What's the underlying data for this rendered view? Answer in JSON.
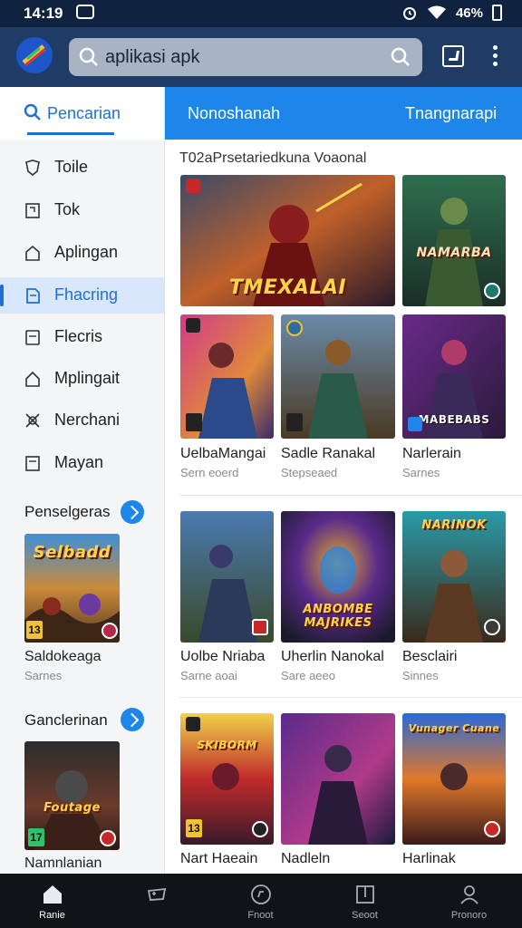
{
  "status_bar": {
    "time": "14:19",
    "battery": "46%"
  },
  "search": {
    "value": "",
    "placeholder": "aplikasi apk"
  },
  "sidebar": {
    "header_label": "Pencarian",
    "items": [
      {
        "label": "Toile",
        "icon": "shield-icon"
      },
      {
        "label": "Tok",
        "icon": "tag-icon"
      },
      {
        "label": "Aplingan",
        "icon": "house-icon"
      },
      {
        "label": "Fhacring",
        "icon": "document-icon",
        "active": true
      },
      {
        "label": "Flecris",
        "icon": "file-icon"
      },
      {
        "label": "Mplingait",
        "icon": "house-outline-icon"
      },
      {
        "label": "Nerchani",
        "icon": "grid-icon"
      },
      {
        "label": "Mayan",
        "icon": "square-icon"
      }
    ],
    "sections": [
      {
        "title": "Penselgeras",
        "card_title": "Saldokeaga",
        "card_sub": "Sarnes",
        "card_art": "Selbadd",
        "age": "13"
      },
      {
        "title": "Ganclerinan",
        "card_title": "Namnlanian",
        "card_sub": "",
        "card_art": "Foutage",
        "age": "17"
      }
    ]
  },
  "tabs": [
    {
      "label": "Nonoshanah",
      "active": true
    },
    {
      "label": "Tnangnarapi",
      "active": false
    }
  ],
  "main": {
    "heading": "T02aPrsetariedkuna Voaonal",
    "featured": [
      {
        "art_text": "TMEXALAI",
        "accent": "#c23b22"
      },
      {
        "art_text": "NAMARBA",
        "accent": "#1f7a4c"
      }
    ],
    "rows": [
      [
        {
          "title": "UelbaMangai",
          "sub": "Sern eoerd",
          "art_text": "",
          "age": ""
        },
        {
          "title": "Sadle Ranakal",
          "sub": "Stepseaed",
          "art_text": "",
          "age": ""
        },
        {
          "title": "Narlerain",
          "sub": "Sarnes",
          "art_text": "MABEBABS",
          "age": ""
        }
      ],
      [
        {
          "title": "Uolbe Nriaba",
          "sub": "Sarne aoai",
          "art_text": "",
          "age": ""
        },
        {
          "title": "Uherlin Nanokal",
          "sub": "Sare aeeo",
          "art_text": "ANBOMBE MAJRIKES",
          "age": ""
        },
        {
          "title": "Besclairi",
          "sub": "Sinnes",
          "art_text": "NARINOK",
          "age": ""
        }
      ],
      [
        {
          "title": "Nart Haeain",
          "sub": "",
          "art_text": "SKIBORM",
          "age": "13"
        },
        {
          "title": "Nadleln",
          "sub": "",
          "art_text": "",
          "age": ""
        },
        {
          "title": "Harlinak",
          "sub": "",
          "art_text": "Vunager Cuane",
          "age": ""
        }
      ]
    ]
  },
  "bottom_nav": [
    {
      "label": "Ranie",
      "icon": "home-icon",
      "active": true
    },
    {
      "label": "",
      "icon": "game-controller-icon"
    },
    {
      "label": "Fnoot",
      "icon": "compass-icon"
    },
    {
      "label": "Seoot",
      "icon": "library-icon"
    },
    {
      "label": "Pronoro",
      "icon": "profile-icon"
    }
  ],
  "colors": {
    "app_bar": "#1e3c66",
    "accent": "#1e86e8",
    "bottom_nav": "#111417"
  }
}
